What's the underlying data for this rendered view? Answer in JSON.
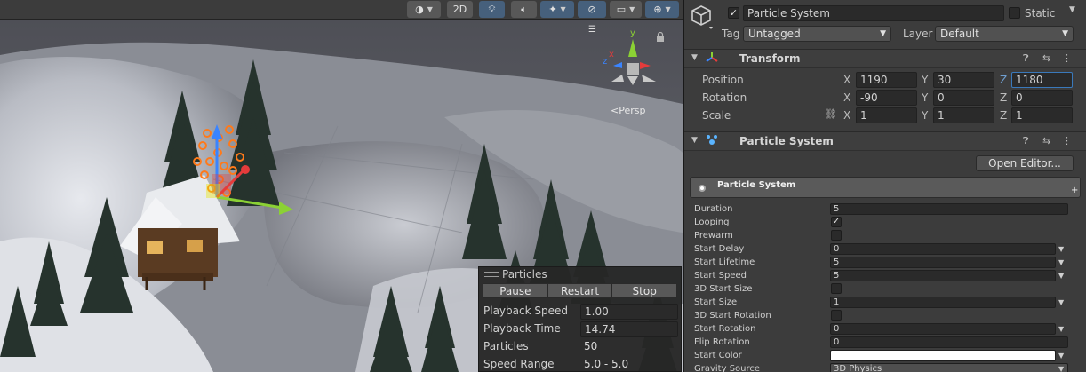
{
  "scene_toolbar": {
    "mode_2d_label": "2D",
    "icons": [
      "draw-mode-icon",
      "lighting-icon",
      "audio-mute-icon",
      "effects-icon",
      "visibility-icon",
      "camera-icon",
      "gizmos-icon"
    ]
  },
  "scene": {
    "persp_label": "<Persp",
    "gizmo_axes": {
      "x": "x",
      "y": "y",
      "z": "z"
    }
  },
  "particles_panel": {
    "title": "Particles",
    "buttons": {
      "pause": "Pause",
      "restart": "Restart",
      "stop": "Stop"
    },
    "rows": [
      {
        "label": "Playback Speed",
        "value": "1.00"
      },
      {
        "label": "Playback Time",
        "value": "14.74"
      },
      {
        "label": "Particles",
        "value": "50"
      },
      {
        "label": "Speed Range",
        "value": "5.0 - 5.0"
      }
    ]
  },
  "inspector": {
    "object_name": "Particle System",
    "active_checked": true,
    "static_label": "Static",
    "tag_label": "Tag",
    "tag_value": "Untagged",
    "layer_label": "Layer",
    "layer_value": "Default",
    "transform": {
      "title": "Transform",
      "position_label": "Position",
      "rotation_label": "Rotation",
      "scale_label": "Scale",
      "position": {
        "x": "1190",
        "y": "30",
        "z": "1180"
      },
      "rotation": {
        "x": "-90",
        "y": "0",
        "z": "0"
      },
      "scale": {
        "x": "1",
        "y": "1",
        "z": "1"
      }
    },
    "particle_component": {
      "title": "Particle System",
      "open_editor": "Open Editor...",
      "module_title": "Particle System",
      "module_plus": "+"
    },
    "properties": {
      "duration": {
        "label": "Duration",
        "value": "5"
      },
      "looping": {
        "label": "Looping",
        "checked": true
      },
      "prewarm": {
        "label": "Prewarm",
        "checked": false
      },
      "start_delay": {
        "label": "Start Delay",
        "value": "0"
      },
      "start_lifetime": {
        "label": "Start Lifetime",
        "value": "5"
      },
      "start_speed": {
        "label": "Start Speed",
        "value": "5"
      },
      "start_size_3d": {
        "label": "3D Start Size",
        "checked": false
      },
      "start_size": {
        "label": "Start Size",
        "value": "1"
      },
      "start_rotation_3d": {
        "label": "3D Start Rotation",
        "checked": false
      },
      "start_rotation": {
        "label": "Start Rotation",
        "value": "0"
      },
      "flip_rotation": {
        "label": "Flip Rotation",
        "value": "0"
      },
      "start_color": {
        "label": "Start Color",
        "color": "#ffffff"
      },
      "gravity_source": {
        "label": "Gravity Source",
        "value": "3D Physics"
      }
    }
  },
  "colors": {
    "selection_blue": "#3a79bb",
    "particle_orange": "#ff7a1a",
    "gizmo_green": "#8bd134",
    "gizmo_red": "#e53b3b",
    "gizmo_blue": "#3a84ff"
  }
}
